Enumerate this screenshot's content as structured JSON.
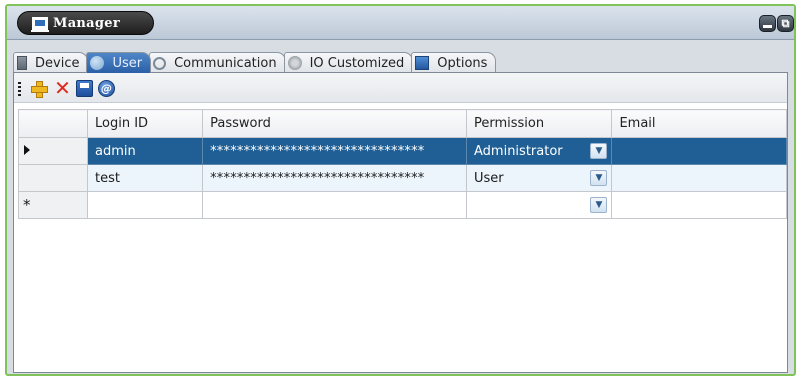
{
  "window": {
    "title": "Manager"
  },
  "tabs": [
    {
      "label": "Device",
      "icon": "device-icon",
      "active": false
    },
    {
      "label": "User",
      "icon": "user-icon",
      "active": true
    },
    {
      "label": "Communication",
      "icon": "communication-icon",
      "active": false
    },
    {
      "label": "IO Customized",
      "icon": "io-icon",
      "active": false
    },
    {
      "label": "Options",
      "icon": "options-icon",
      "active": false
    }
  ],
  "toolbar": {
    "buttons": [
      "add-icon",
      "delete-icon",
      "save-icon",
      "info-icon"
    ]
  },
  "grid": {
    "columns": [
      "Login ID",
      "Password",
      "Permission",
      "Email"
    ],
    "rows": [
      {
        "login_id": "admin",
        "password": "********************************",
        "permission": "Administrator",
        "email": "",
        "selected": true
      },
      {
        "login_id": "test",
        "password": "********************************",
        "permission": "User",
        "email": "",
        "selected": false
      }
    ],
    "new_row_marker": "*"
  },
  "colors": {
    "frame": "#7fc35a",
    "selection": "#1f5f95",
    "active_tab": "#2b60a8"
  }
}
